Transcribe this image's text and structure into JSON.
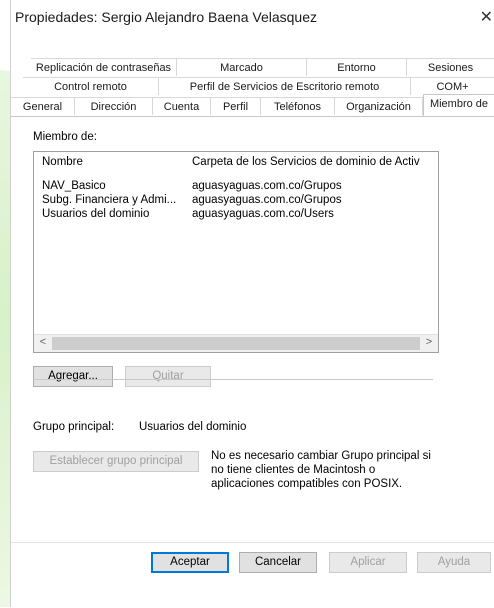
{
  "window": {
    "title": "Propiedades: Sergio Alejandro Baena Velasquez",
    "close_glyph": "✕"
  },
  "tabs": {
    "row1": [
      "Replicación de contraseñas",
      "Marcado",
      "Entorno",
      "Sesiones"
    ],
    "row2": [
      "Control remoto",
      "Perfil de Servicios de Escritorio remoto",
      "COM+"
    ],
    "row3": [
      "General",
      "Dirección",
      "Cuenta",
      "Perfil",
      "Teléfonos",
      "Organización",
      "Miembro de"
    ],
    "selected": "Miembro de"
  },
  "member_of": {
    "label": "Miembro de:",
    "columns": [
      "Nombre",
      "Carpeta de los Servicios de dominio de Activ"
    ],
    "rows": [
      {
        "name": "NAV_Basico",
        "folder": "aguasyaguas.com.co/Grupos"
      },
      {
        "name": "Subg. Financiera y Admi...",
        "folder": "aguasyaguas.com.co/Grupos"
      },
      {
        "name": "Usuarios del dominio",
        "folder": "aguasyaguas.com.co/Users"
      }
    ],
    "scroll_left": "<",
    "scroll_right": ">"
  },
  "actions": {
    "add": "Agregar...",
    "remove": "Quitar"
  },
  "primary_group": {
    "label": "Grupo principal:",
    "value": "Usuarios del dominio",
    "set_button": "Establecer grupo principal",
    "note": "No es necesario cambiar Grupo principal si no tiene clientes de Macintosh o aplicaciones compatibles con POSIX."
  },
  "footer": {
    "ok": "Aceptar",
    "cancel": "Cancelar",
    "apply": "Aplicar",
    "help": "Ayuda"
  },
  "colors": {
    "accent_green": "#d8f1c9",
    "default_button_border": "#0078d7"
  }
}
